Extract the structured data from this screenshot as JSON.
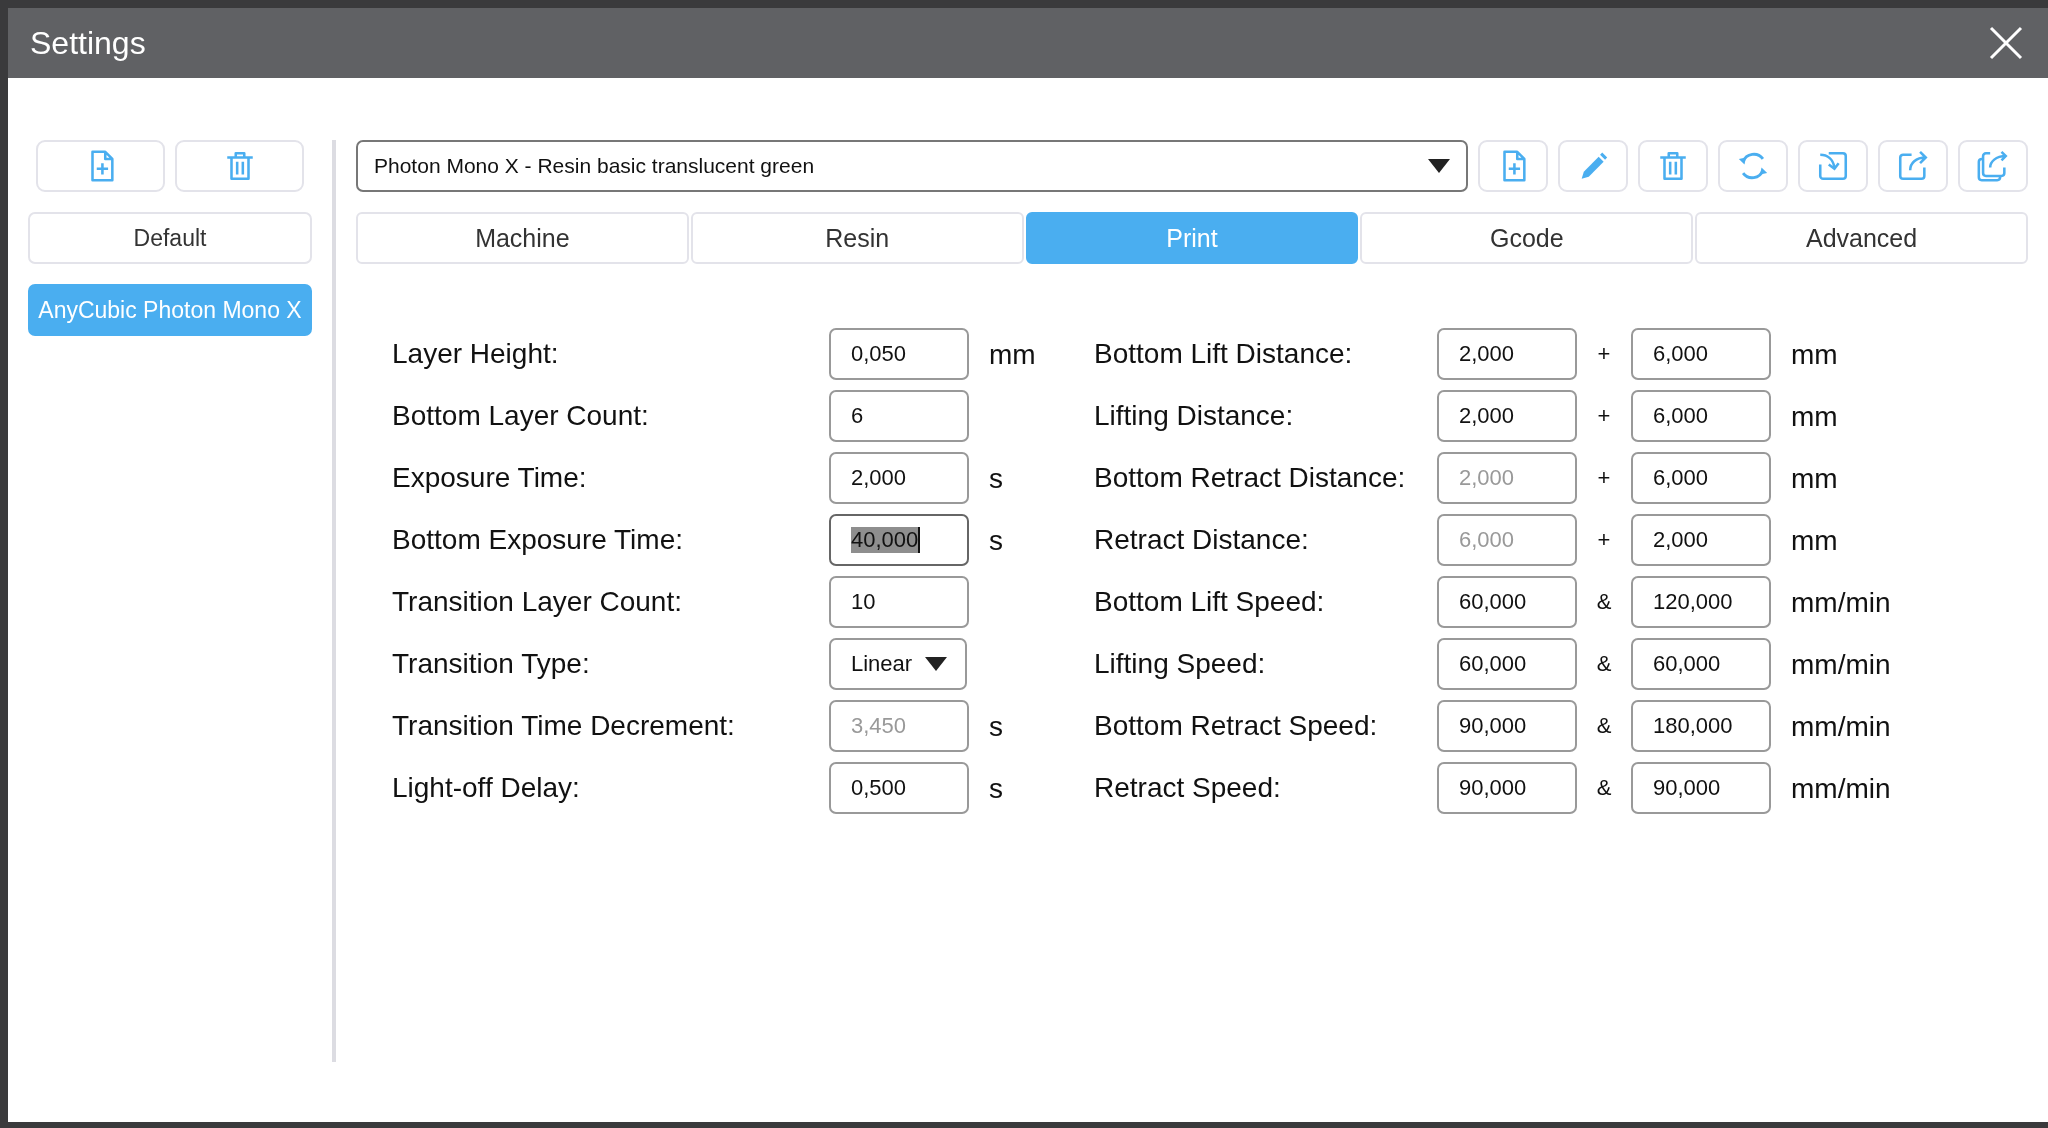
{
  "window": {
    "title": "Settings"
  },
  "profiles": [
    {
      "label": "Default",
      "selected": false
    },
    {
      "label": "AnyCubic Photon Mono X",
      "selected": true
    }
  ],
  "preset": {
    "value": "Photon Mono X - Resin basic translucent green"
  },
  "tabs": [
    {
      "label": "Machine",
      "selected": false
    },
    {
      "label": "Resin",
      "selected": false
    },
    {
      "label": "Print",
      "selected": true
    },
    {
      "label": "Gcode",
      "selected": false
    },
    {
      "label": "Advanced",
      "selected": false
    }
  ],
  "left_rows": [
    {
      "label": "Layer Height:",
      "kind": "input",
      "value": "0,050",
      "disabled": false,
      "text_selected": false,
      "unit": "mm"
    },
    {
      "label": "Bottom Layer Count:",
      "kind": "input",
      "value": "6",
      "disabled": false,
      "text_selected": false
    },
    {
      "label": "Exposure Time:",
      "kind": "input",
      "value": "2,000",
      "disabled": false,
      "text_selected": false,
      "unit": "s"
    },
    {
      "label": "Bottom Exposure Time:",
      "kind": "input",
      "value": "40,000",
      "disabled": false,
      "text_selected": true,
      "unit": "s"
    },
    {
      "label": "Transition Layer Count:",
      "kind": "input",
      "value": "10",
      "disabled": false,
      "text_selected": false
    },
    {
      "label": "Transition Type:",
      "kind": "dropdown",
      "value": "Linear",
      "disabled": false
    },
    {
      "label": "Transition Time Decrement:",
      "kind": "input",
      "value": "3,450",
      "disabled": true,
      "text_selected": false,
      "unit": "s"
    },
    {
      "label": "Light-off Delay:",
      "kind": "input",
      "value": "0,500",
      "disabled": false,
      "text_selected": false,
      "unit": "s"
    }
  ],
  "right_rows": [
    {
      "label": "Bottom Lift Distance:",
      "first": {
        "value": "2,000",
        "disabled": false
      },
      "joiner": "+",
      "second": {
        "value": "6,000",
        "disabled": false
      },
      "unit": "mm"
    },
    {
      "label": "Lifting Distance:",
      "first": {
        "value": "2,000",
        "disabled": false
      },
      "joiner": "+",
      "second": {
        "value": "6,000",
        "disabled": false
      },
      "unit": "mm"
    },
    {
      "label": "Bottom Retract Distance:",
      "first": {
        "value": "2,000",
        "disabled": true
      },
      "joiner": "+",
      "second": {
        "value": "6,000",
        "disabled": false
      },
      "unit": "mm"
    },
    {
      "label": "Retract Distance:",
      "first": {
        "value": "6,000",
        "disabled": true
      },
      "joiner": "+",
      "second": {
        "value": "2,000",
        "disabled": false
      },
      "unit": "mm"
    },
    {
      "label": "Bottom Lift Speed:",
      "first": {
        "value": "60,000",
        "disabled": false
      },
      "joiner": "&",
      "second": {
        "value": "120,000",
        "disabled": false
      },
      "unit": "mm/min"
    },
    {
      "label": "Lifting Speed:",
      "first": {
        "value": "60,000",
        "disabled": false
      },
      "joiner": "&",
      "second": {
        "value": "60,000",
        "disabled": false
      },
      "unit": "mm/min"
    },
    {
      "label": "Bottom Retract Speed:",
      "first": {
        "value": "90,000",
        "disabled": false
      },
      "joiner": "&",
      "second": {
        "value": "180,000",
        "disabled": false
      },
      "unit": "mm/min"
    },
    {
      "label": "Retract Speed:",
      "first": {
        "value": "90,000",
        "disabled": false
      },
      "joiner": "&",
      "second": {
        "value": "90,000",
        "disabled": false
      },
      "unit": "mm/min"
    }
  ]
}
